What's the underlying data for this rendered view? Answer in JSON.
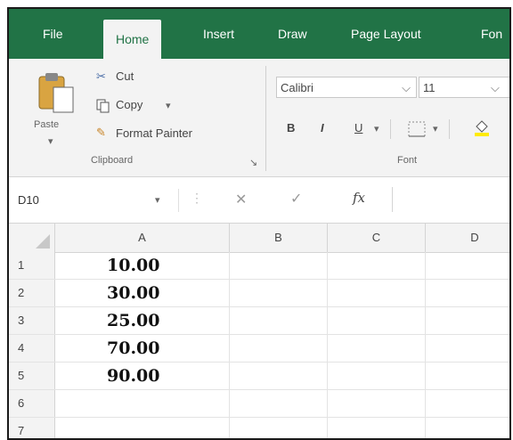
{
  "tabs": [
    {
      "label": "File",
      "active": false
    },
    {
      "label": "Home",
      "active": true
    },
    {
      "label": "Insert",
      "active": false
    },
    {
      "label": "Draw",
      "active": false
    },
    {
      "label": "Page Layout",
      "active": false
    },
    {
      "label": "Fon",
      "active": false
    }
  ],
  "ribbon": {
    "clipboard": {
      "paste_label": "Paste",
      "cut_label": "Cut",
      "copy_label": "Copy",
      "copy_arrow": "▾",
      "format_painter_label": "Format Painter",
      "group_label": "Clipboard"
    },
    "font": {
      "font_name": "Calibri",
      "font_size": "11",
      "bold": "B",
      "italic": "I",
      "underline": "U",
      "group_label": "Font"
    }
  },
  "formula_bar": {
    "name_box": "D10",
    "cancel": "✕",
    "enter": "✓",
    "fx": "fx",
    "formula_value": ""
  },
  "grid": {
    "columns": [
      "A",
      "B",
      "C",
      "D"
    ],
    "rows": [
      {
        "num": "1",
        "a": "10.00"
      },
      {
        "num": "2",
        "a": "30.00"
      },
      {
        "num": "3",
        "a": "25.00"
      },
      {
        "num": "4",
        "a": "70.00"
      },
      {
        "num": "5",
        "a": "90.00"
      },
      {
        "num": "6",
        "a": ""
      },
      {
        "num": "7",
        "a": ""
      }
    ]
  },
  "colors": {
    "accent": "#217346",
    "ribbon_bg": "#f3f3f3"
  }
}
